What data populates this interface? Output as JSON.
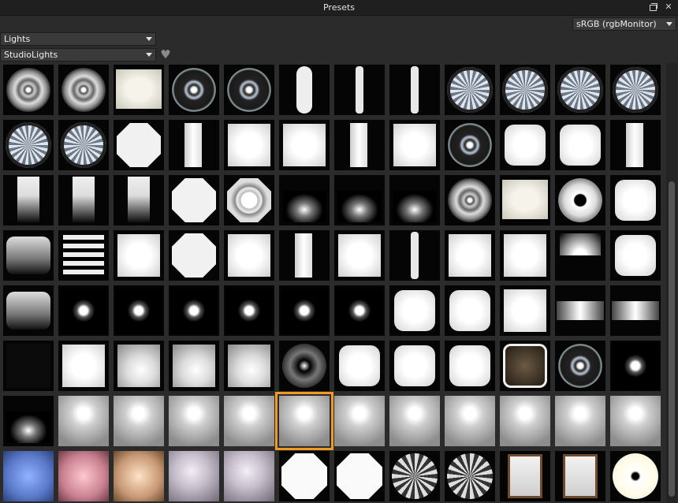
{
  "window": {
    "title": "Presets"
  },
  "colorspace": {
    "value": "sRGB (rgbMonitor)"
  },
  "library": {
    "value": "Lights"
  },
  "category": {
    "value": "StudioLights"
  },
  "icons": {
    "restore": "restore-icon",
    "close": "close-icon",
    "favorite": "heart-icon",
    "dropdown": "chevron-down-icon"
  },
  "colors": {
    "selection": "#f09a24",
    "panel": "#2b2b2b",
    "tile": "#050505"
  },
  "presets": [
    [
      "ring",
      "ring",
      "soft",
      "disc",
      "disc",
      "pill",
      "bar",
      "bar",
      "umbrella",
      "umbrella",
      "umbrella",
      "umbrella"
    ],
    [
      "umbrella",
      "umbrella",
      "octa",
      "strip",
      "square",
      "square",
      "strip",
      "square",
      "disc",
      "rounded",
      "rounded",
      "strip"
    ],
    [
      "fade",
      "fade",
      "fade",
      "octa",
      "octagrid",
      "glow",
      "glow",
      "glow",
      "ring",
      "soft",
      "donut",
      "rounded"
    ],
    [
      "fadebar",
      "stripes",
      "square",
      "octa",
      "square",
      "strip",
      "square",
      "bar",
      "square",
      "square",
      "topfade",
      "rounded"
    ],
    [
      "fadebar",
      "spot",
      "spot",
      "spot",
      "spot",
      "spot",
      "spot",
      "rounded",
      "rounded",
      "square",
      "band",
      "band"
    ],
    [
      "dark",
      "square",
      "gradsq",
      "gradsq",
      "gradsq",
      "radial",
      "rounded",
      "rounded",
      "rounded",
      "window",
      "disc",
      "spot"
    ],
    [
      "glow",
      "grad",
      "grad",
      "grad",
      "grad",
      "grad",
      "grad",
      "grad",
      "grad",
      "grad",
      "grad",
      "grad"
    ],
    [
      "blue",
      "pink",
      "peach",
      "studio",
      "studio",
      "umbrellaw",
      "umbrellaw",
      "umbrellab",
      "umbrellab",
      "frame",
      "frame",
      "donutw"
    ]
  ],
  "selected": {
    "row": 6,
    "col": 5
  }
}
